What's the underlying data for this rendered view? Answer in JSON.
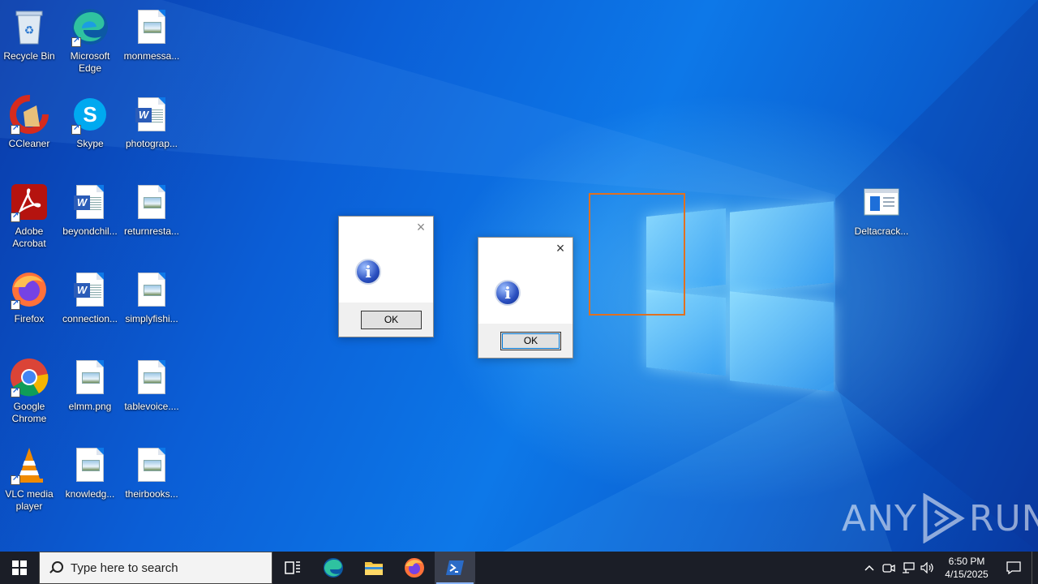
{
  "desktop_icons": [
    {
      "label": "Recycle Bin"
    },
    {
      "label": "Microsoft Edge"
    },
    {
      "label": "monmessa..."
    },
    {
      "label": "CCleaner"
    },
    {
      "label": "Skype"
    },
    {
      "label": "photograp..."
    },
    {
      "label": "Adobe Acrobat"
    },
    {
      "label": "beyondchil..."
    },
    {
      "label": "returnresta..."
    },
    {
      "label": "Firefox"
    },
    {
      "label": "connection..."
    },
    {
      "label": "simplyfishi..."
    },
    {
      "label": "Google Chrome"
    },
    {
      "label": "elmm.png"
    },
    {
      "label": "tablevoice...."
    },
    {
      "label": "VLC media player"
    },
    {
      "label": "knowledg..."
    },
    {
      "label": "theirbooks..."
    },
    {
      "label": "Deltacrack..."
    }
  ],
  "dialogs": [
    {
      "ok_label": "OK",
      "close_label": "×"
    },
    {
      "ok_label": "OK",
      "close_label": "×"
    }
  ],
  "watermark": {
    "left": "ANY",
    "right": "RUN"
  },
  "taskbar": {
    "search_placeholder": "Type here to search",
    "clock_time": "6:50 PM",
    "clock_date": "4/15/2025"
  },
  "colors": {
    "taskbar": "#1b1e27",
    "highlight": "#e07020",
    "desktop": "#0d78e8"
  }
}
